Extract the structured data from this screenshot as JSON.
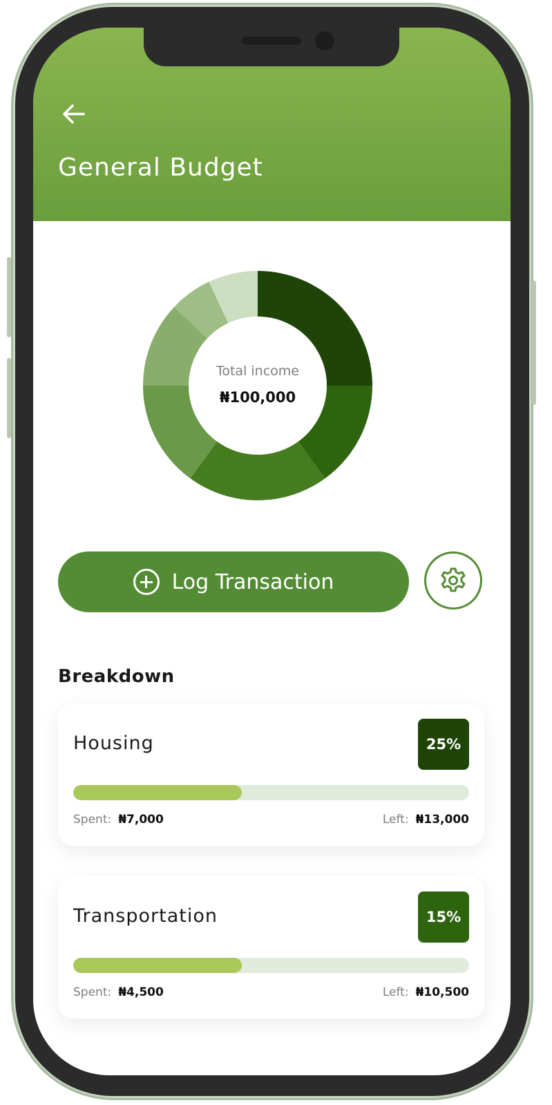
{
  "header": {
    "title": "General Budget"
  },
  "summary": {
    "total_label": "Total income",
    "total_value": "₦100,000"
  },
  "chart_data": {
    "type": "pie",
    "slices": [
      {
        "value": 25,
        "color": "#1f4408"
      },
      {
        "value": 15,
        "color": "#2e640e"
      },
      {
        "value": 20,
        "color": "#447c1f"
      },
      {
        "value": 15,
        "color": "#6b994a"
      },
      {
        "value": 12,
        "color": "#89ad6b"
      },
      {
        "value": 6,
        "color": "#9ebe86"
      },
      {
        "value": 7,
        "color": "#ccdec0"
      }
    ]
  },
  "actions": {
    "log_label": "Log Transaction"
  },
  "breakdown": {
    "title": "Breakdown",
    "items": [
      {
        "name": "Housing",
        "percent": "25%",
        "badge_color": "#1f4408",
        "spent_label": "Spent:",
        "spent": "₦7,000",
        "left_label": "Left:",
        "left": "₦13,000",
        "progress": 0.425
      },
      {
        "name": "Transportation",
        "percent": "15%",
        "badge_color": "#2e640e",
        "spent_label": "Spent:",
        "spent": "₦4,500",
        "left_label": "Left:",
        "left": "₦10,500",
        "progress": 0.425
      }
    ]
  },
  "icons": {
    "back": "arrow-left-icon",
    "add": "plus-circle-icon",
    "settings": "gear-icon"
  }
}
